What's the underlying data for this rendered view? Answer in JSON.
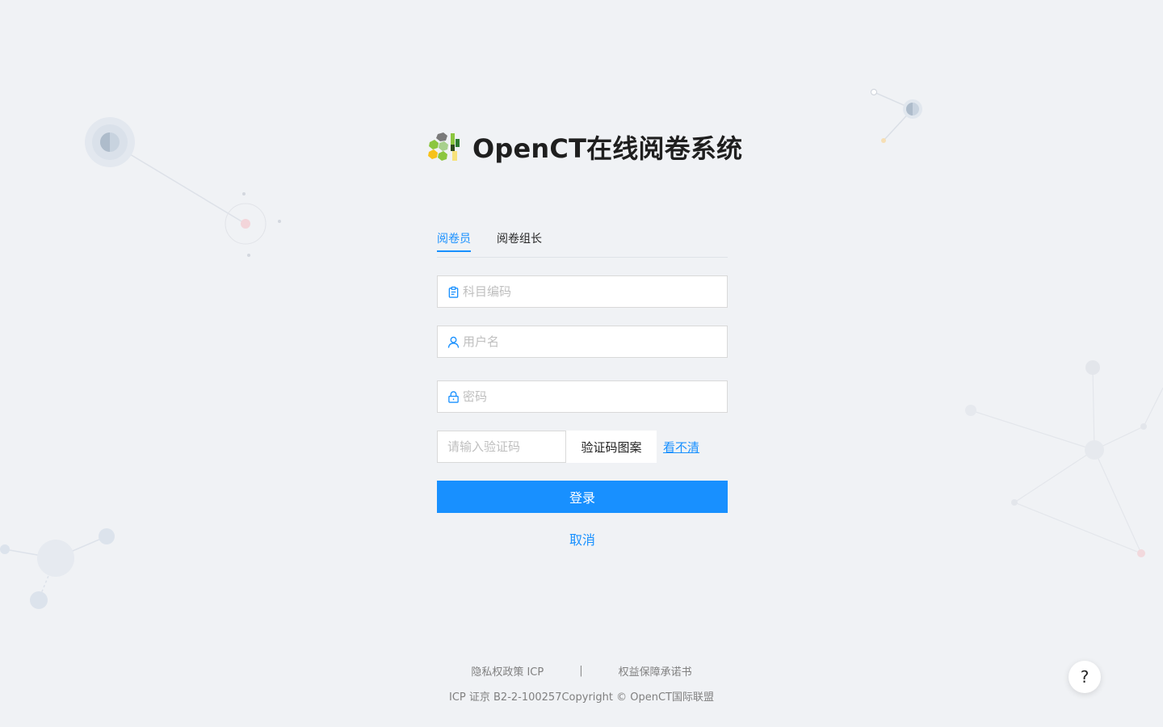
{
  "header": {
    "title": "OpenCT在线阅卷系统",
    "logo_icon": "hexagon-cluster-logo-icon"
  },
  "tabs": [
    {
      "label": "阅卷员",
      "active": true
    },
    {
      "label": "阅卷组长",
      "active": false
    }
  ],
  "form": {
    "subject_placeholder": "科目编码",
    "subject_value": "",
    "subject_icon": "clipboard-icon",
    "username_placeholder": "用户名",
    "username_value": "",
    "username_icon": "user-icon",
    "password_placeholder": "密码",
    "password_value": "",
    "password_icon": "lock-icon",
    "captcha_placeholder": "请输入验证码",
    "captcha_value": "",
    "captcha_image_text": "验证码图案",
    "refresh_label": "看不清",
    "login_label": "登录",
    "cancel_label": "取消"
  },
  "footer": {
    "privacy": "隐私权政策 ICP",
    "separator": "|",
    "rights": "权益保障承诺书",
    "copyright": "ICP 证京 B2-2-100257Copyright © OpenCT国际联盟"
  },
  "help": {
    "label": "?",
    "icon": "question-icon"
  },
  "colors": {
    "primary": "#1890ff",
    "background": "#f0f2f5",
    "logo_gray": "#7a7a7a",
    "logo_green": "#8cc63f",
    "logo_yellow": "#f7c21a",
    "logo_dark_green": "#2e7d32"
  }
}
